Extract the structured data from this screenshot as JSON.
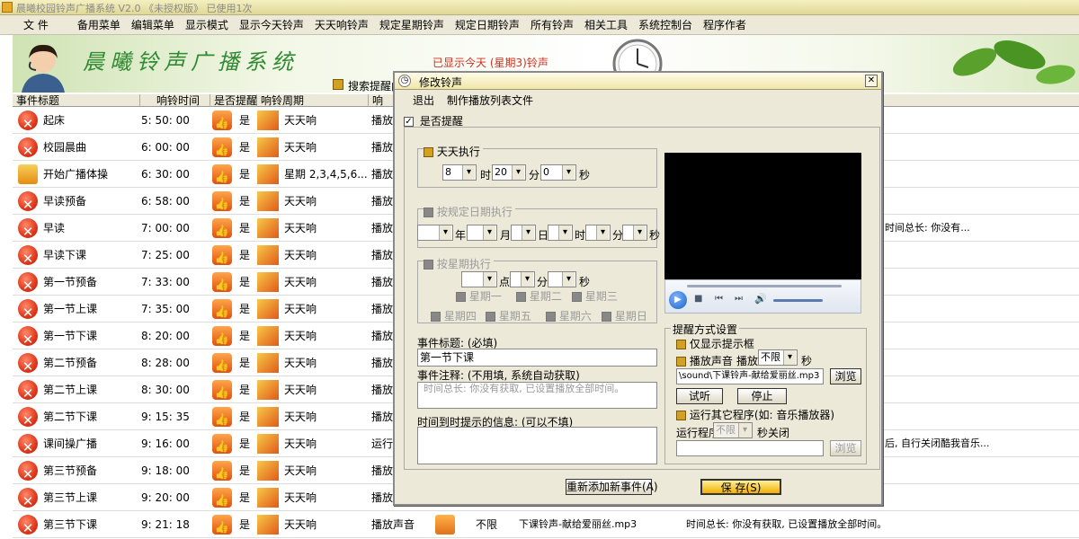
{
  "app": {
    "title": "晨曦校园铃声广播系统 V2.0 《未授权版》 已使用1次"
  },
  "menu": [
    "文 件",
    "备用菜单",
    "编辑菜单",
    "显示模式",
    "显示今天铃声",
    "天天响铃声",
    "规定星期铃声",
    "规定日期铃声",
    "所有铃声",
    "相关工具",
    "系统控制台",
    "程序作者"
  ],
  "banner": {
    "logo": "晨曦铃声广播系统",
    "notice": "已显示今天 (星期3)铃声"
  },
  "subbar": {
    "label": "搜索提醒内"
  },
  "columns": [
    "事件标题",
    "响铃时间",
    "是否提醒",
    "响铃周期",
    "响"
  ],
  "rows": [
    {
      "title": "起床",
      "time": "5: 50: 00",
      "remind": "是",
      "period": "天天响",
      "col5": "播放"
    },
    {
      "title": "校园晨曲",
      "time": "6: 00: 00",
      "remind": "是",
      "period": "天天响",
      "col5": "播放"
    },
    {
      "title": "开始广播体操",
      "time": "6: 30: 00",
      "remind": "是",
      "period": "星期 2,3,4,5,6...",
      "col5": "播放"
    },
    {
      "title": "早读预备",
      "time": "6: 58: 00",
      "remind": "是",
      "period": "天天响",
      "col5": "播放"
    },
    {
      "title": "早读",
      "time": "7: 00: 00",
      "remind": "是",
      "period": "天天响",
      "col5": "播放",
      "extra": "时间总长:  你没有..."
    },
    {
      "title": "早读下课",
      "time": "7: 25: 00",
      "remind": "是",
      "period": "天天响",
      "col5": "播放"
    },
    {
      "title": "第一节预备",
      "time": "7: 33: 00",
      "remind": "是",
      "period": "天天响",
      "col5": "播放"
    },
    {
      "title": "第一节上课",
      "time": "7: 35: 00",
      "remind": "是",
      "period": "天天响",
      "col5": "播放"
    },
    {
      "title": "第一节下课",
      "time": "8: 20: 00",
      "remind": "是",
      "period": "天天响",
      "col5": "播放"
    },
    {
      "title": "第二节预备",
      "time": "8: 28: 00",
      "remind": "是",
      "period": "天天响",
      "col5": "播放"
    },
    {
      "title": "第二节上课",
      "time": "8: 30: 00",
      "remind": "是",
      "period": "天天响",
      "col5": "播放"
    },
    {
      "title": "第二节下课",
      "time": "9: 15: 35",
      "remind": "是",
      "period": "天天响",
      "col5": "播放"
    },
    {
      "title": "课间操广播",
      "time": "9: 16: 00",
      "remind": "是",
      "period": "天天响",
      "col5": "运行",
      "extra": "后, 自行关闭酷我音乐..."
    },
    {
      "title": "第三节预备",
      "time": "9: 18: 00",
      "remind": "是",
      "period": "天天响",
      "col5": "播放"
    },
    {
      "title": "第三节上课",
      "time": "9: 20: 00",
      "remind": "是",
      "period": "天天响",
      "col5": "播放"
    },
    {
      "title": "第三节下课",
      "time": "9: 21: 18",
      "remind": "是",
      "period": "天天响",
      "col5": "播放声音",
      "col6": "不限",
      "col7": "下课铃声-献给爱丽丝.mp3",
      "extra": "时间总长:  你没有获取, 已设置播放全部时间。"
    }
  ],
  "dialog": {
    "title": "修改铃声",
    "menu": [
      "退出",
      "制作播放列表文件"
    ],
    "remind_label": "是否提醒",
    "daily": {
      "label": "天天执行",
      "hour": "8",
      "min": "20",
      "sec": "0",
      "u_h": "时",
      "u_m": "分",
      "u_s": "秒"
    },
    "bydate": {
      "label": "按规定日期执行",
      "u": [
        "年",
        "月",
        "日",
        "时",
        "分",
        "秒"
      ]
    },
    "byweek": {
      "label": "按星期执行",
      "u": [
        "点",
        "分",
        "秒"
      ],
      "days": [
        "星期一",
        "星期二",
        "星期三",
        "星期四",
        "星期五",
        "星期六",
        "星期日"
      ]
    },
    "title_label": "事件标题: (必填)",
    "title_value": "第一节下课",
    "note_label": "事件注释: (不用填, 系统自动获取)",
    "note_value": "时间总长:  你没有获取, 已设置播放全部时间。",
    "msg_label": "时间到时提示的信息: (可以不填)",
    "method": {
      "group": "提醒方式设置",
      "only_box": "仅显示提示框",
      "play_sound": "播放声音",
      "play": "播放",
      "play_value": "不限",
      "sec": "秒",
      "file": "\\sound\\下课铃声-献给爱丽丝.mp3",
      "browse": "浏览",
      "preview": "试听",
      "stop": "停止",
      "run_other": "运行其它程序(如: 音乐播放器)",
      "run_prog": "运行程序",
      "run_value": "不限",
      "close_after": "秒关闭",
      "browse2": "浏览"
    },
    "readd": "重新添加新事件(A)",
    "save": "保 存(S)"
  },
  "colors": {
    "accent_green": "#2f8a31",
    "notice_red": "#d03020",
    "icon_gold": "#d4a020"
  }
}
